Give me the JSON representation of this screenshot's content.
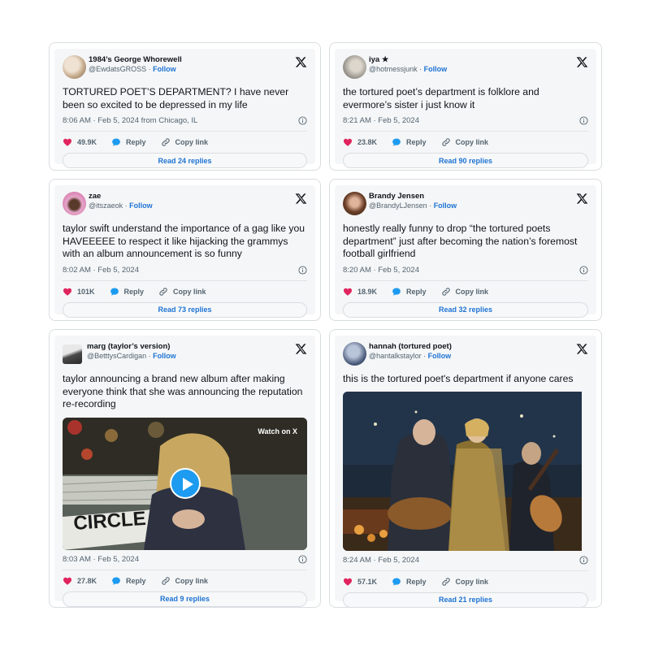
{
  "tweets": [
    {
      "display_name": "1984’s George Whorewell",
      "handle": "@EwdatsGROSS",
      "follow": "Follow",
      "text": "TORTURED POET’S DEPARTMENT? I have never been so excited to be depressed in my life",
      "meta": "8:06 AM · Feb 5, 2024 from Chicago, IL",
      "likes": "49.9K",
      "reply_label": "Reply",
      "copy_label": "Copy link",
      "read_replies": "Read 24 replies"
    },
    {
      "display_name": "iya ★",
      "handle": "@hotmessjunk",
      "follow": "Follow",
      "text": "the tortured poet’s department is folklore and evermore’s sister i just know it",
      "meta": "8:21 AM · Feb 5, 2024",
      "likes": "23.8K",
      "reply_label": "Reply",
      "copy_label": "Copy link",
      "read_replies": "Read 90 replies"
    },
    {
      "display_name": "zae",
      "handle": "@itszaeok",
      "follow": "Follow",
      "text": "taylor swift understand the importance of a gag like you HAVEEEEE to respect it like hijacking the grammys with an album announcement is so funny",
      "meta": "8:02 AM · Feb 5, 2024",
      "likes": "101K",
      "reply_label": "Reply",
      "copy_label": "Copy link",
      "read_replies": "Read 73 replies"
    },
    {
      "display_name": "Brandy Jensen",
      "handle": "@BrandyLJensen",
      "follow": "Follow",
      "text": "honestly really funny to drop “the tortured poets department” just after becoming the nation’s foremost football girlfriend",
      "meta": "8:20 AM · Feb 5, 2024",
      "likes": "18.9K",
      "reply_label": "Reply",
      "copy_label": "Copy link",
      "read_replies": "Read 32 replies"
    },
    {
      "display_name": "marg (taylor’s version)",
      "handle": "@BetttysCardigan",
      "follow": "Follow",
      "text": "taylor announcing a brand new album after making everyone think that she was announcing the reputation re-recording",
      "media_watch": "Watch on X",
      "media_sign": "CIRCLE",
      "meta": "8:03 AM · Feb 5, 2024",
      "likes": "27.8K",
      "reply_label": "Reply",
      "copy_label": "Copy link",
      "read_replies": "Read 9 replies"
    },
    {
      "display_name": "hannah (tortured poet)",
      "handle": "@hantalkstaylor",
      "follow": "Follow",
      "text": "this is the tortured poet's department if anyone cares",
      "meta": "8:24 AM · Feb 5, 2024",
      "likes": "57.1K",
      "reply_label": "Reply",
      "copy_label": "Copy link",
      "read_replies": "Read 21 replies"
    }
  ],
  "icons": {
    "platform": "x-logo-icon",
    "like": "heart-icon",
    "reply": "reply-bubble-icon",
    "copy": "link-icon",
    "info": "info-icon",
    "play": "play-icon"
  },
  "colors": {
    "like": "#e0245e",
    "reply": "#1d9bf0",
    "link": "#1d73d4",
    "card_bg": "#f5f6f7"
  }
}
